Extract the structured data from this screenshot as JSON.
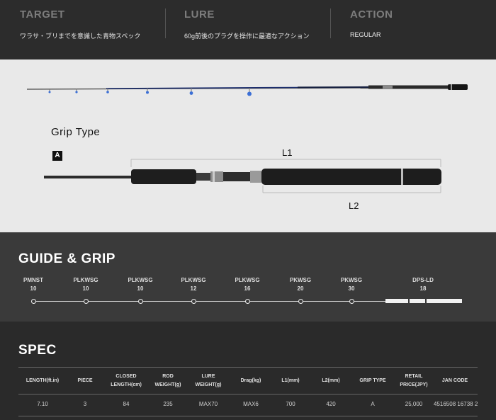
{
  "summary": {
    "target": {
      "label": "TARGET",
      "value": "ワラサ・ブリまでを意識した青物スペック"
    },
    "lure": {
      "label": "LURE",
      "value": "60g前後のプラグを操作に最適なアクション"
    },
    "action": {
      "label": "ACTION",
      "value": "REGULAR"
    }
  },
  "grip": {
    "title": "Grip Type",
    "badge": "A",
    "l1_label": "L1",
    "l2_label": "L2"
  },
  "guide": {
    "title": "GUIDE & GRIP",
    "items": [
      {
        "name": "PMNST",
        "size": "10"
      },
      {
        "name": "PLKWSG",
        "size": "10"
      },
      {
        "name": "PLKWSG",
        "size": "10"
      },
      {
        "name": "PLKWSG",
        "size": "12"
      },
      {
        "name": "PLKWSG",
        "size": "16"
      },
      {
        "name": "PKWSG",
        "size": "20"
      },
      {
        "name": "PKWSG",
        "size": "30"
      },
      {
        "name": "DPS-LD",
        "size": "18"
      }
    ]
  },
  "spec": {
    "title": "SPEC",
    "headers": [
      "LENGTH(ft.in)",
      "PIECE",
      "CLOSED LENGTH(cm)",
      "ROD WEIGHT(g)",
      "LURE WEIGHT(g)",
      "Drag(kg)",
      "L1(mm)",
      "L2(mm)",
      "GRIP TYPE",
      "RETAIL PRICE(JPY)",
      "JAN CODE"
    ],
    "row": [
      "7.10",
      "3",
      "84",
      "235",
      "MAX70",
      "MAX6",
      "700",
      "420",
      "A",
      "25,000",
      "4516508 16738 2"
    ]
  },
  "colors": {
    "dark": "#2c2c2c",
    "guide_bg": "#3a3a3a",
    "spec_bg": "#2a2a2a",
    "light_bg": "#e9e9e9",
    "rod_blue": "#3b6fd6"
  }
}
